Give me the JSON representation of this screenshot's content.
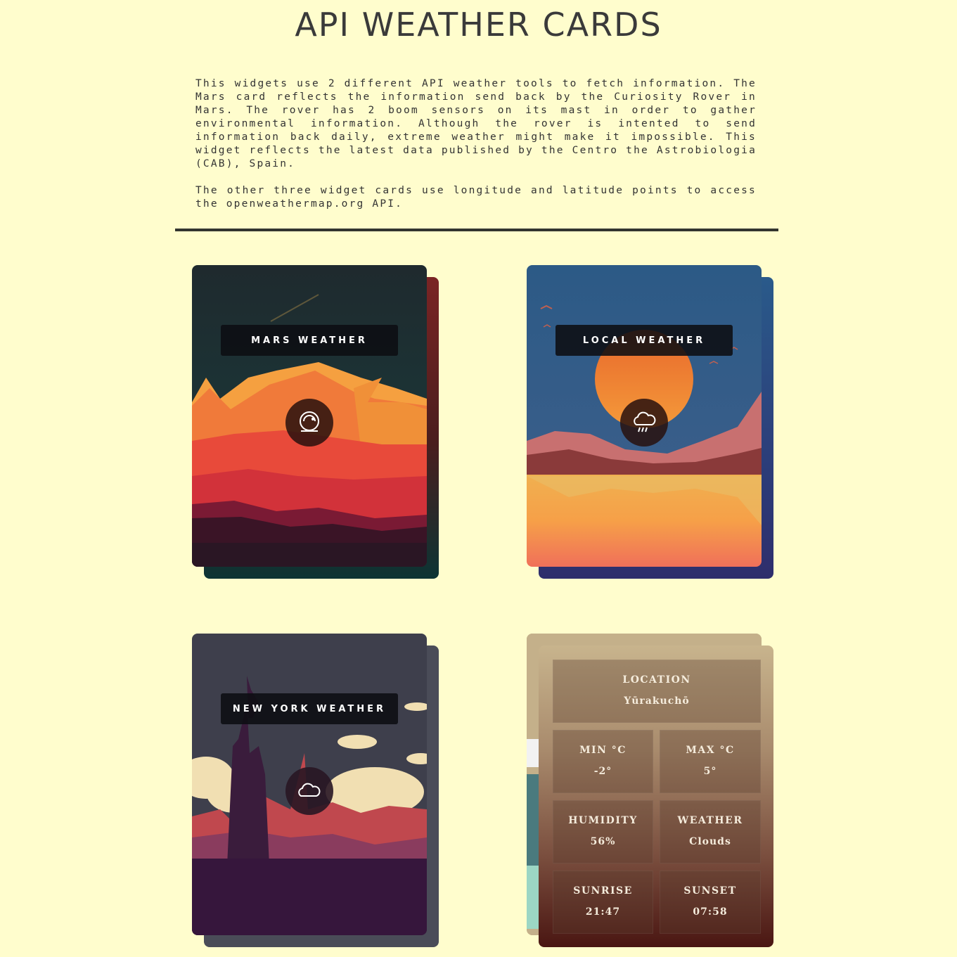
{
  "page": {
    "title": "API WEATHER CARDS",
    "intro_1": "This widgets use 2 different API weather tools to fetch information. The Mars card reflects the information send back by the Curiosity Rover in Mars. The rover has 2 boom sensors on its mast in order to gather environmental information. Although the rover is intented to send information back daily, extreme weather might make it impossible. This widget reflects the latest data published by the Centro the Astrobiologia (CAB), Spain.",
    "intro_2": "The other three widget cards use longitude and latitude points to access the openweathermap.org API."
  },
  "cards": {
    "mars": {
      "label": "MARS WEATHER",
      "icon": "astronaut-helmet-icon"
    },
    "local": {
      "label": "LOCAL WEATHER",
      "icon": "cloud-rain-icon"
    },
    "newyork": {
      "label": "NEW YORK WEATHER",
      "icon": "cloud-icon"
    }
  },
  "data_card": {
    "location_label": "LOCATION",
    "location_value": "Yūrakuchō",
    "min_label": "MIN °C",
    "min_value": "-2°",
    "max_label": "MAX °C",
    "max_value": "5°",
    "humidity_label": "HUMIDITY",
    "humidity_value": "56%",
    "weather_label": "WEATHER",
    "weather_value": "Clouds",
    "sunrise_label": "SUNRISE",
    "sunrise_value": "21:47",
    "sunset_label": "SUNSET",
    "sunset_value": "07:58"
  },
  "colors": {
    "background": "#fffdcd",
    "divider": "#33352f",
    "mars_back": "#7a2424",
    "local_back": "#303a7a",
    "newyork_back": "#4a4c58"
  }
}
